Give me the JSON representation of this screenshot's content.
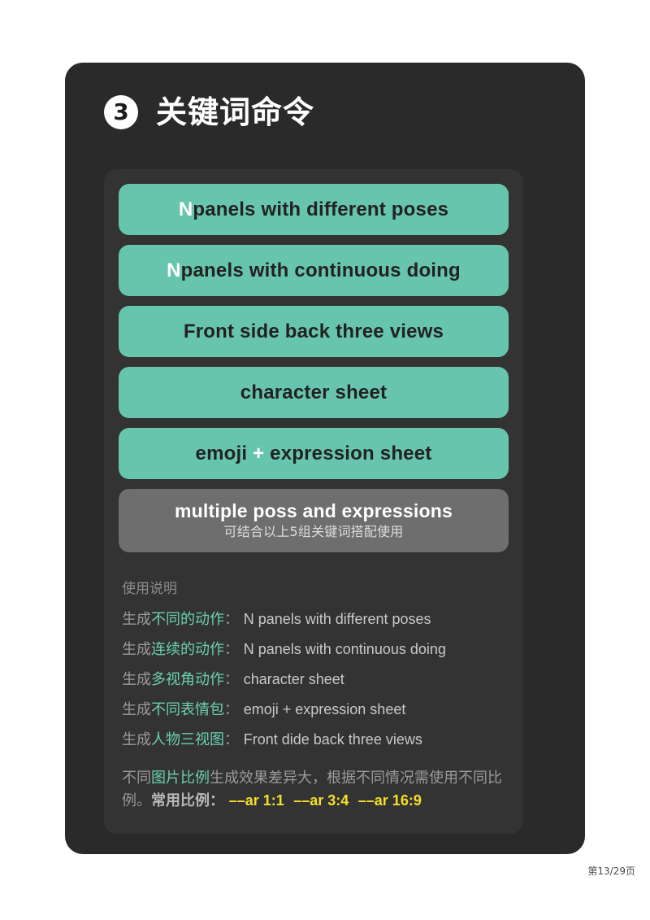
{
  "card": {
    "step_number": "❸",
    "step_number_plain": "3",
    "title": "关键词命令"
  },
  "chips": [
    {
      "prefix": "N",
      "text": " panels with different poses",
      "name": "chip-different-poses"
    },
    {
      "prefix": "N",
      "text": " panels with continuous doing",
      "name": "chip-continuous-doing"
    },
    {
      "prefix": "",
      "text": "Front side back three views",
      "name": "chip-three-views"
    },
    {
      "prefix": "",
      "text": "character sheet",
      "name": "chip-character-sheet"
    },
    {
      "prefix": "",
      "text": "emoji",
      "mid": "+",
      "suffix": "expression sheet",
      "name": "chip-expression-sheet"
    }
  ],
  "note_chip": {
    "main": "multiple poss and expressions",
    "sub": "可结合以上5组关键词搭配使用"
  },
  "usage": {
    "title": "使用说明",
    "rows": [
      {
        "cn_plain": "生成",
        "cn_em": "不同的动作",
        "colon": "：",
        "en": "N panels with different poses"
      },
      {
        "cn_plain": "生成",
        "cn_em": "连续的动作",
        "colon": "：",
        "en": "N panels with continuous doing"
      },
      {
        "cn_plain": "生成",
        "cn_em": "多视角动作",
        "colon": "：",
        "en": "character sheet"
      },
      {
        "cn_plain": "生成",
        "cn_em": "不同表情包",
        "colon": "：",
        "en": "emoji + expression sheet"
      },
      {
        "cn_plain": "生成",
        "cn_em": "人物三视图",
        "colon": "：",
        "en": "Front dide back three views"
      }
    ],
    "paragraph": {
      "part1": "不同",
      "em": "图片比例",
      "part2": "生成效果差异大，根据不同情况需使用不同比例。",
      "label": "常用比例：",
      "ratios": [
        "––ar 1:1",
        "––ar 3:4",
        "––ar 16:9"
      ]
    }
  },
  "footer": {
    "page_label": "第13/29页"
  },
  "colors": {
    "page_bg": "#ffffff",
    "card_bg": "#2a2a2a",
    "panel_bg": "#333333",
    "chip_green": "#68c5ad",
    "chip_gray": "#6e6e6e",
    "accent_green": "#6ad0b2",
    "accent_yellow": "#f3e02a",
    "text_gray": "#9a9a9a"
  }
}
